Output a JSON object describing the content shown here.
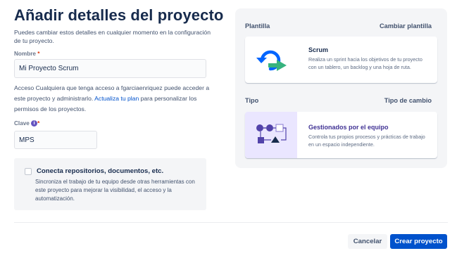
{
  "header": {
    "title": "Añadir detalles del proyecto",
    "subtitle": "Puedes cambiar estos detalles en cualquier momento en la configuración de tu proyecto."
  },
  "form": {
    "name_label": "Nombre",
    "name_value": "Mi Proyecto Scrum",
    "access_label": "Acceso",
    "access_text": "Cualquiera que tenga acceso a fgarciaenriquez puede acceder a este proyecto y administrarlo.",
    "access_link": "Actualiza tu plan",
    "access_text_after": "para personalizar los permisos de los proyectos.",
    "key_label": "Clave",
    "key_value": "MPS",
    "required_mark": "*"
  },
  "connect": {
    "title": "Conecta repositorios, documentos, etc.",
    "description": "Sincroniza el trabajo de tu equipo desde otras herramientas con este proyecto para mejorar la visibilidad, el acceso y la automatización."
  },
  "template_section": {
    "heading": "Plantilla",
    "action": "Cambiar plantilla",
    "card_title": "Scrum",
    "card_desc": "Realiza un sprint hacia los objetivos de tu proyecto con un tablero, un backlog y una hoja de ruta."
  },
  "type_section": {
    "heading": "Tipo",
    "action": "Tipo de cambio",
    "card_title": "Gestionados por el equipo",
    "card_desc": "Controla tus propios procesos y prácticas de trabajo en un espacio independiente."
  },
  "footer": {
    "cancel_label": "Cancelar",
    "create_label": "Crear proyecto"
  },
  "colors": {
    "primary": "#0052cc",
    "scrum_blue": "#0065ff",
    "scrum_green": "#36b37e",
    "purple": "#6554c0",
    "type_bg": "#eae6ff"
  },
  "icons": [
    "info-icon",
    "checkbox-icon",
    "scrum-illustration",
    "team-managed-illustration"
  ]
}
